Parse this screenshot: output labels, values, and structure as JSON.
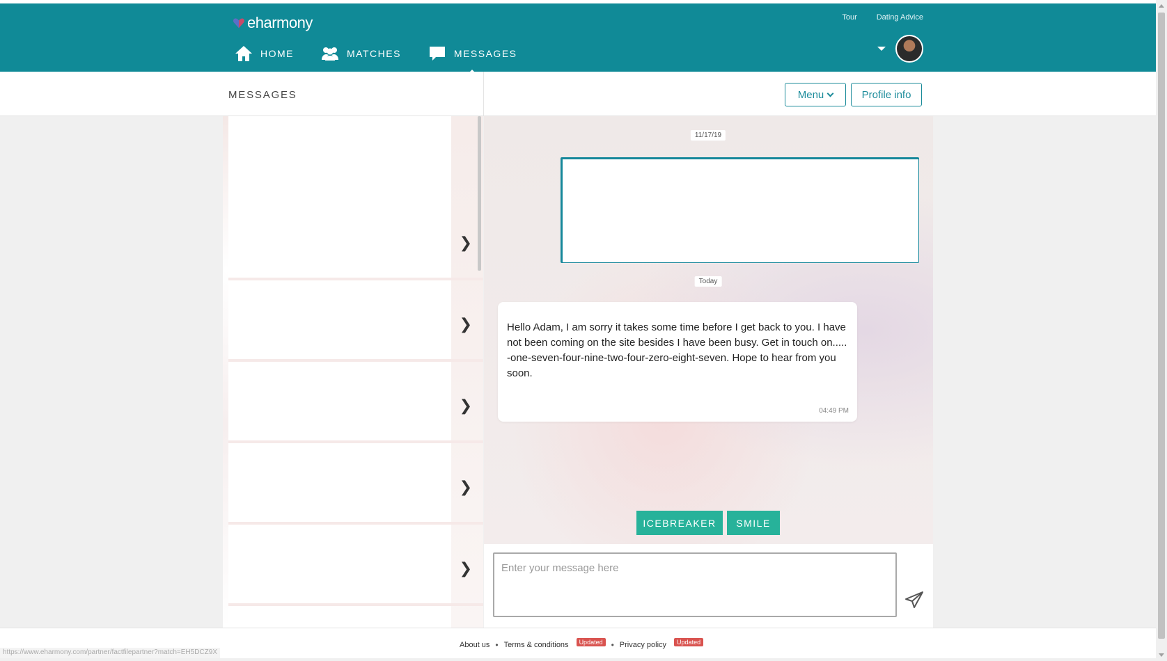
{
  "brand": {
    "logo_text": "eharmony",
    "colors": {
      "header": "#108a97",
      "accent": "#1b8b9a",
      "quick_button": "#27b29a",
      "badge": "#d9534f"
    }
  },
  "toplinks": [
    "Tour",
    "Dating Advice"
  ],
  "nav": [
    {
      "label": "HOME",
      "icon": "home-icon"
    },
    {
      "label": "MATCHES",
      "icon": "people-icon"
    },
    {
      "label": "MESSAGES",
      "icon": "chat-bubble-icon",
      "active": true
    }
  ],
  "subbar": {
    "title": "MESSAGES",
    "menu_label": "Menu",
    "profile_label": "Profile info"
  },
  "chat": {
    "date_1": "11/17/19",
    "date_2": "Today",
    "message": {
      "text": "Hello Adam, I am sorry it takes some time before I get back to you. I have not been coming on the site besides I have been busy. Get in touch on.....        -one-seven-four-nine-two-four-zero-eight-seven. Hope to hear from you soon.",
      "time": "04:49 PM"
    },
    "quick_buttons": {
      "icebreaker": "ICEBREAKER",
      "smile": "SMILE"
    },
    "compose_placeholder": "Enter your message here"
  },
  "footer": {
    "about": "About us",
    "terms": "Terms & conditions",
    "privacy": "Privacy policy",
    "badge": "Updated"
  },
  "status_url": "https://www.eharmony.com/partner/factfilepartner?match=EH5DCZ9X"
}
